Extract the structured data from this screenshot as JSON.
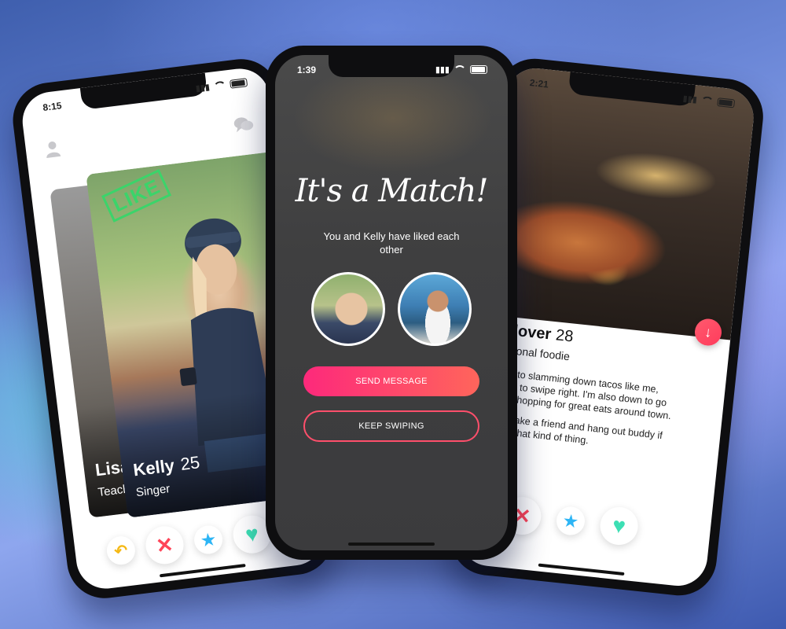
{
  "left_phone": {
    "time": "8:15",
    "back_card": {
      "name": "Lisa",
      "job": "Teacher"
    },
    "front_card": {
      "stamp": "LIKE",
      "name": "Kelly",
      "age": "25",
      "job": "Singer"
    }
  },
  "center_phone": {
    "time": "1:39",
    "title": "It's a Match!",
    "subtitle": "You and Kelly have liked each other",
    "send_button": "SEND MESSAGE",
    "keep_button": "KEEP SWIPING"
  },
  "right_phone": {
    "time": "2:21",
    "name": "Taco lover",
    "age": "28",
    "job": "Professional foodie",
    "bio": [
      "If you're into slamming down tacos like me, make sure to swipe right.  I'm also down to go restaurant hopping for great eats around town.",
      "Down to make a friend and hang out buddy if you're into that kind of thing."
    ]
  },
  "icons": {
    "undo": "undo-icon",
    "nope": "x-icon",
    "superlike": "star-icon",
    "like": "heart-icon",
    "profile": "person-icon",
    "messages": "chat-icon",
    "info": "arrow-down-icon"
  },
  "colors": {
    "accent_start": "#fd297b",
    "accent_end": "#ff655b",
    "like_green": "#3bd46a",
    "undo_yellow": "#f5b916",
    "nope_red": "#ff4458",
    "star_blue": "#2db5f5",
    "heart_teal": "#3ddfb4"
  }
}
